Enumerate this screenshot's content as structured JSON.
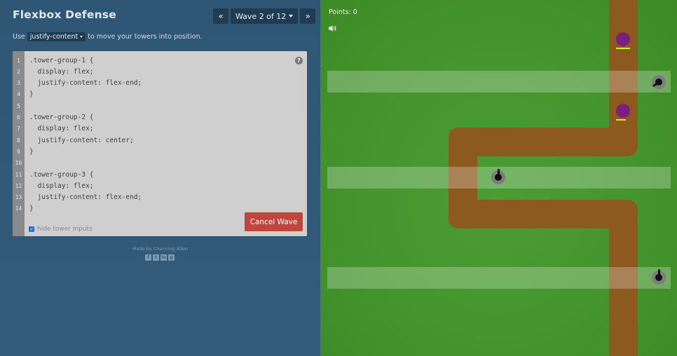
{
  "app": {
    "title": "Flexbox Defense"
  },
  "wave_nav": {
    "prev_label": "«",
    "wave_label": "Wave 2 of 12",
    "next_label": "»"
  },
  "instruction": {
    "prefix": "Use",
    "property": "justify-content",
    "suffix": "to move your towers into position."
  },
  "editor": {
    "lines": [
      {
        "num": "1",
        "code": ".tower-group-1 {"
      },
      {
        "num": "2",
        "code": "  display: flex;"
      },
      {
        "num": "3",
        "code": "  justify-content: flex-end;"
      },
      {
        "num": "4",
        "code": "}"
      },
      {
        "num": "5",
        "code": ""
      },
      {
        "num": "6",
        "code": ".tower-group-2 {"
      },
      {
        "num": "7",
        "code": "  display: flex;"
      },
      {
        "num": "8",
        "code": "  justify-content: center;"
      },
      {
        "num": "9",
        "code": "}"
      },
      {
        "num": "10",
        "code": ""
      },
      {
        "num": "11",
        "code": ".tower-group-3 {"
      },
      {
        "num": "12",
        "code": "  display: flex;"
      },
      {
        "num": "13",
        "code": "  justify-content: flex-end;"
      },
      {
        "num": "14",
        "code": "}"
      }
    ],
    "help_label": "?",
    "hide_inputs_label": "hide tower inputs",
    "hide_inputs_checked": true,
    "cancel_label": "Cancel Wave"
  },
  "footer": {
    "credit": "Made by Channing Allen",
    "social_icons": [
      "facebook-icon",
      "twitter-icon",
      "linkedin-icon",
      "github-icon"
    ]
  },
  "game": {
    "points_label": "Points: 0",
    "sound_icon": "speaker-icon",
    "colors": {
      "grass": "#44952d",
      "path": "#8c5a1f",
      "enemy": "#7b1f7e",
      "health": "#c9ef1e",
      "cancel": "#c0453f"
    }
  }
}
